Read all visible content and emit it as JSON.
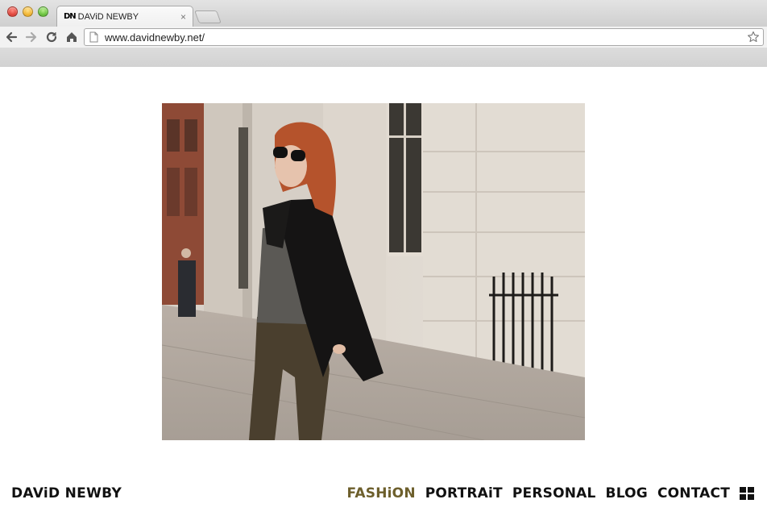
{
  "browser": {
    "tab": {
      "favicon_text": "DN",
      "title": "DAViD NEWBY"
    },
    "url": "www.davidnewby.net/"
  },
  "site": {
    "name": "DAViD NEWBY",
    "nav": [
      {
        "label": "FASHiON",
        "active": true
      },
      {
        "label": "PORTRAiT",
        "active": false
      },
      {
        "label": "PERSONAL",
        "active": false
      },
      {
        "label": "BLOG",
        "active": false
      },
      {
        "label": "CONTACT",
        "active": false
      }
    ],
    "colors": {
      "active_nav": "#6d5f2c",
      "nav": "#111111"
    },
    "icons": {
      "grid": "grid-icon"
    }
  }
}
